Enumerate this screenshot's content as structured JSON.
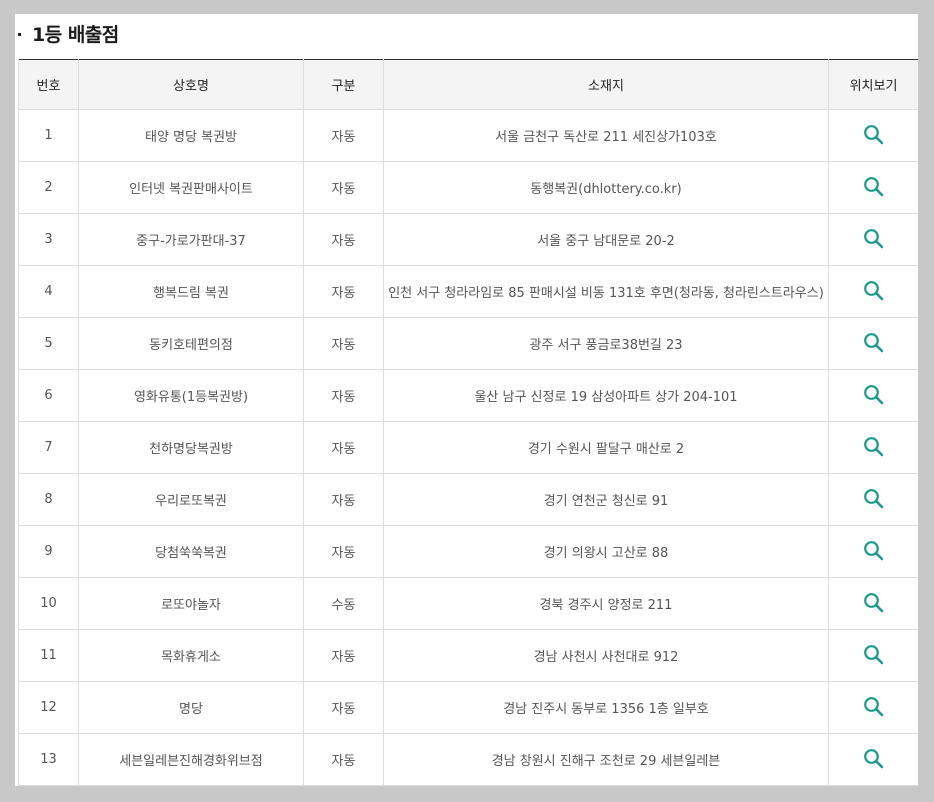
{
  "section": {
    "title": "1등 배출점"
  },
  "table": {
    "headers": [
      "번호",
      "상호명",
      "구분",
      "소재지",
      "위치보기"
    ],
    "rows": [
      {
        "no": "1",
        "name": "태양 명당 복권방",
        "type": "자동",
        "address": "서울 금천구 독산로 211 세진상가103호"
      },
      {
        "no": "2",
        "name": "인터넷 복권판매사이트",
        "type": "자동",
        "address": "동행복권(dhlottery.co.kr)"
      },
      {
        "no": "3",
        "name": "중구-가로가판대-37",
        "type": "자동",
        "address": "서울 중구 남대문로 20-2"
      },
      {
        "no": "4",
        "name": "행복드림 복권",
        "type": "자동",
        "address": "인천 서구 청라라임로 85 판매시설 비동 131호 후면(청라동, 청라린스트라우스)"
      },
      {
        "no": "5",
        "name": "동키호테편의점",
        "type": "자동",
        "address": "광주 서구 풍금로38번길 23"
      },
      {
        "no": "6",
        "name": "영화유통(1등복권방)",
        "type": "자동",
        "address": "울산 남구 신정로 19 삼성아파트 상가 204-101"
      },
      {
        "no": "7",
        "name": "천하명당복권방",
        "type": "자동",
        "address": "경기 수원시 팔달구 매산로 2"
      },
      {
        "no": "8",
        "name": "우리로또복권",
        "type": "자동",
        "address": "경기 연천군 청신로 91"
      },
      {
        "no": "9",
        "name": "당첨쑥쑥복권",
        "type": "자동",
        "address": "경기 의왕시 고산로 88"
      },
      {
        "no": "10",
        "name": "로또야놀자",
        "type": "수동",
        "address": "경북 경주시 양정로 211"
      },
      {
        "no": "11",
        "name": "목화휴게소",
        "type": "자동",
        "address": "경남 사천시 사천대로 912"
      },
      {
        "no": "12",
        "name": "명당",
        "type": "자동",
        "address": "경남 진주시 동부로 1356 1층 일부호"
      },
      {
        "no": "13",
        "name": "세븐일레븐진해경화위브점",
        "type": "자동",
        "address": "경남 창원시 진해구 조천로 29 세븐일레븐"
      }
    ],
    "location_icon": "search-icon"
  },
  "colors": {
    "icon": "#1e9a8c",
    "header_bg": "#f4f4f4",
    "page_bg": "#c8c8c8"
  }
}
